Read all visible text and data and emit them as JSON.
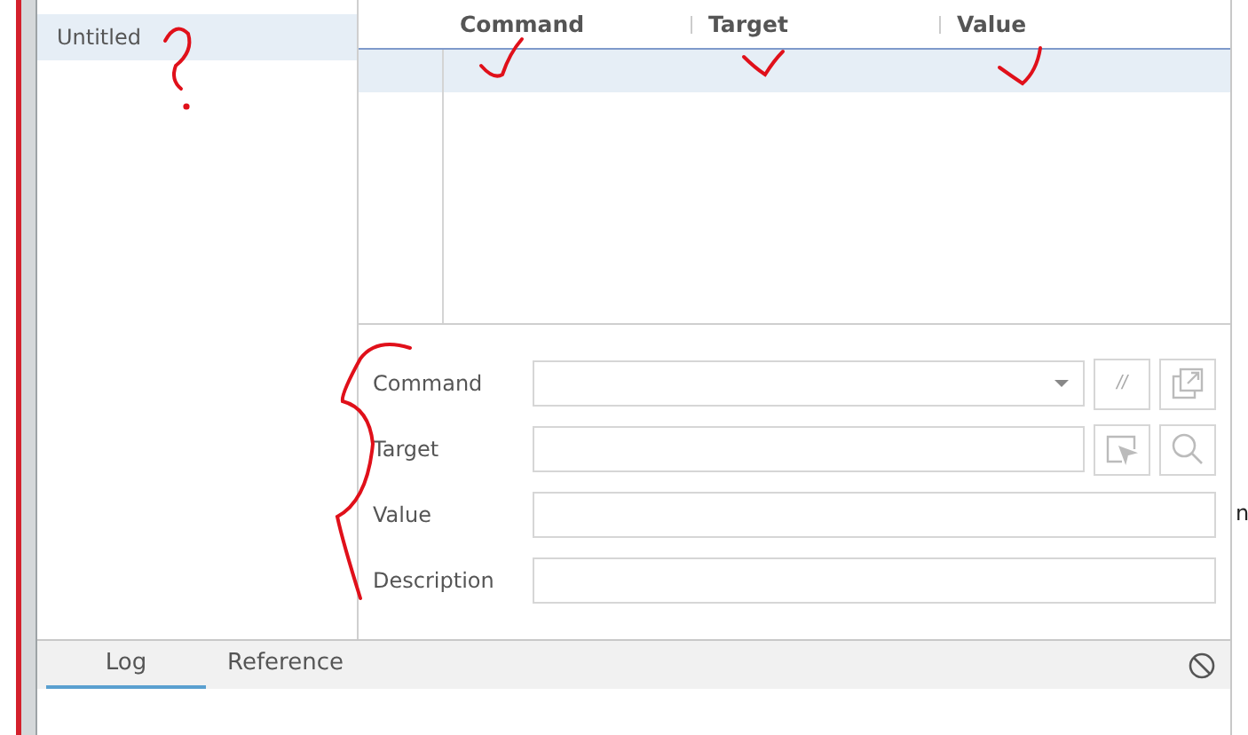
{
  "sidebar": {
    "items": [
      {
        "label": "Untitled",
        "selected": true
      }
    ]
  },
  "table": {
    "columns": [
      "Command",
      "Target",
      "Value"
    ],
    "rows": [
      {
        "selected": true
      }
    ]
  },
  "editor": {
    "fields": [
      {
        "label": "Command",
        "kind": "dropdown",
        "toggle_label": "//"
      },
      {
        "label": "Target",
        "kind": "target"
      },
      {
        "label": "Value",
        "kind": "text"
      },
      {
        "label": "Description",
        "kind": "text"
      }
    ]
  },
  "bottom_panel": {
    "tabs": [
      {
        "label": "Log",
        "selected": true
      },
      {
        "label": "Reference",
        "selected": false
      }
    ]
  },
  "edge_text": "n"
}
